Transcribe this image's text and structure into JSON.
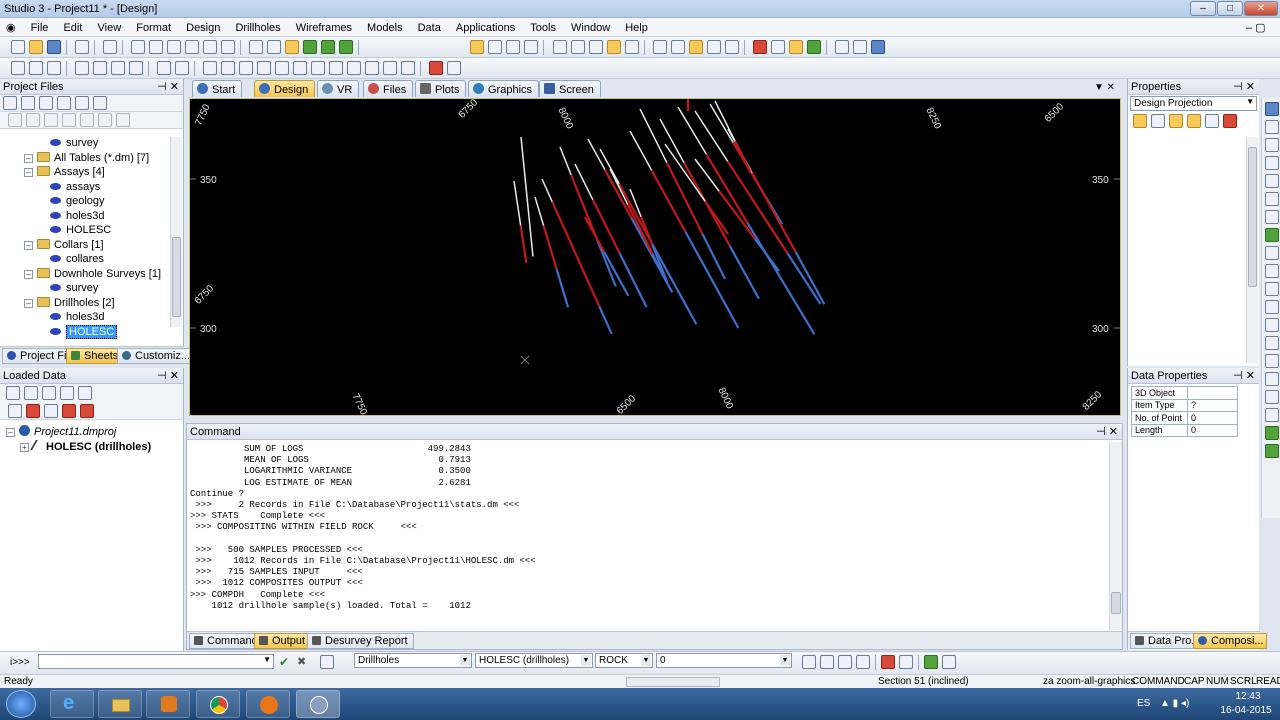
{
  "window": {
    "title": "Studio 3 - Project11 * - [Design]"
  },
  "menu": [
    "File",
    "Edit",
    "View",
    "Format",
    "Design",
    "Drillholes",
    "Wireframes",
    "Models",
    "Data",
    "Applications",
    "Tools",
    "Window",
    "Help"
  ],
  "project_files": {
    "title": "Project Files",
    "tree": [
      {
        "label": "survey",
        "level": 2,
        "kind": "table"
      },
      {
        "label": "All Tables (*.dm) [7]",
        "level": 1,
        "kind": "folder"
      },
      {
        "label": "Assays [4]",
        "level": 1,
        "kind": "folder"
      },
      {
        "label": "assays",
        "level": 2,
        "kind": "table"
      },
      {
        "label": "geology",
        "level": 2,
        "kind": "table"
      },
      {
        "label": "holes3d",
        "level": 2,
        "kind": "table"
      },
      {
        "label": "HOLESC",
        "level": 2,
        "kind": "table"
      },
      {
        "label": "Collars [1]",
        "level": 1,
        "kind": "folder"
      },
      {
        "label": "collares",
        "level": 2,
        "kind": "table"
      },
      {
        "label": "Downhole Surveys [1]",
        "level": 1,
        "kind": "folder"
      },
      {
        "label": "survey",
        "level": 2,
        "kind": "table"
      },
      {
        "label": "Drillholes [2]",
        "level": 1,
        "kind": "folder"
      },
      {
        "label": "holes3d",
        "level": 2,
        "kind": "table"
      },
      {
        "label": "HOLESC",
        "level": 2,
        "kind": "table",
        "selected": true
      }
    ],
    "tabs": [
      "Project Fi...",
      "Sheets",
      "Customiz..."
    ]
  },
  "loaded_data": {
    "title": "Loaded Data",
    "project": "Project11.dmproj",
    "item": "HOLESC (drillholes)"
  },
  "view_tabs": [
    {
      "label": "Start"
    },
    {
      "label": "Design",
      "selected": true
    },
    {
      "label": "VR"
    },
    {
      "label": "Files"
    },
    {
      "label": "Plots"
    },
    {
      "label": "Graphics"
    },
    {
      "label": "Screen"
    }
  ],
  "viewport": {
    "top_labels": [
      "7750",
      "6750",
      "8000",
      "8250",
      "6500"
    ],
    "bottom_labels": [
      "7750",
      "6500",
      "8000",
      "8250"
    ],
    "left_labels": [
      "350",
      "6750",
      "300"
    ],
    "right_labels": [
      "350",
      "300"
    ],
    "colors": {
      "red": "#c3181c",
      "blue": "#3f6fcc",
      "white": "#e8e8e8",
      "bg": "#000000",
      "frame": "#c9c46a"
    }
  },
  "command": {
    "title": "Command",
    "lines": [
      "          SUM OF LOGS                       499.2843",
      "          MEAN OF LOGS                        0.7913",
      "          LOGARITHMIC VARIANCE                0.3500",
      "          LOG ESTIMATE OF MEAN                2.6281",
      "Continue ?",
      " >>>     2 Records in File C:\\Database\\Project11\\stats.dm <<<",
      ">>> STATS    Complete <<<",
      " >>> COMPOSITING WITHIN FIELD ROCK     <<<",
      "",
      " >>>   500 SAMPLES PROCESSED <<<",
      " >>>    1012 Records in File C:\\Database\\Project11\\HOLESC.dm <<<",
      " >>>   715 SAMPLES INPUT     <<<",
      " >>>  1012 COMPOSITES OUTPUT <<<",
      ">>> COMPDH   Complete <<<",
      "    1012 drillhole sample(s) loaded. Total =    1012"
    ],
    "tabs": [
      "Command",
      "Output",
      "Desurvey Report"
    ]
  },
  "properties": {
    "title": "Properties",
    "dropdown": "Design Projection"
  },
  "data_properties": {
    "title": "Data Properties",
    "rows": [
      {
        "key": "3D Object",
        "value": ""
      },
      {
        "key": "Item Type",
        "value": "?"
      },
      {
        "key": "No. of Point",
        "value": "0"
      },
      {
        "key": "Length",
        "value": "0"
      }
    ],
    "tabs": [
      "Data Pro...",
      "Composi..."
    ]
  },
  "cmdline": {
    "prompt": "i>>>",
    "combo1": "Drillholes",
    "combo2": "HOLESC (drillholes)",
    "combo3": "ROCK",
    "combo4": "0"
  },
  "status": {
    "left": "Ready",
    "section": "Section 51 (inclined)",
    "command": "za zoom-all-graphics",
    "indicators": [
      "COMMAND",
      "CAP",
      "NUM",
      "SCRL",
      "READ"
    ]
  },
  "taskbar": {
    "lang": "ES",
    "time": "12:43",
    "date": "16-04-2015"
  }
}
